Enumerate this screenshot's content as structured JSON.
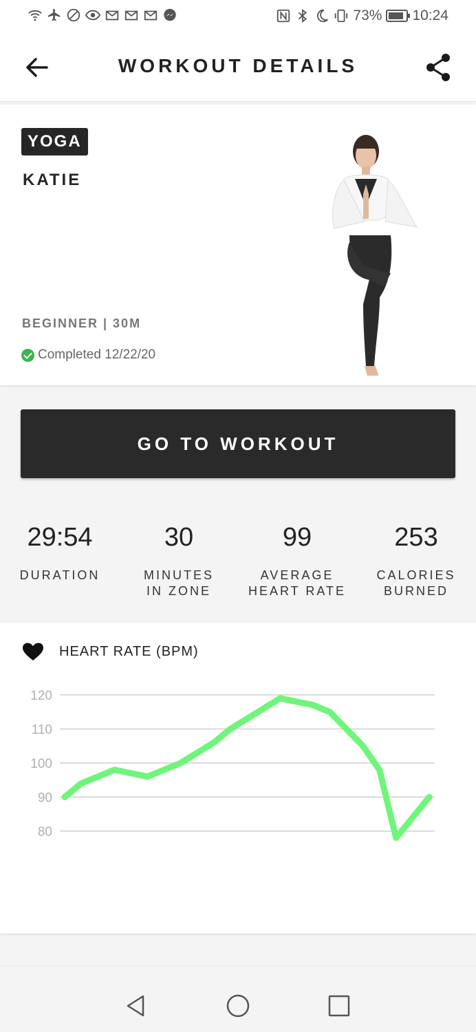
{
  "status_bar": {
    "left_icons": [
      "wifi-icon",
      "airplane-icon",
      "blocked-icon",
      "eye-icon",
      "gmail-icon",
      "gmail-icon",
      "gmail-icon",
      "messenger-icon"
    ],
    "right_icons": [
      "nfc-icon",
      "bluetooth-icon",
      "moon-icon",
      "vibrate-icon"
    ],
    "battery": "73%",
    "time": "10:24"
  },
  "header": {
    "title": "WORKOUT DETAILS",
    "back_icon": "arrow-left-icon",
    "share_icon": "share-icon"
  },
  "workout": {
    "category": "YOGA",
    "instructor": "KATIE",
    "meta": "BEGINNER | 30M",
    "completed": "Completed 12/22/20"
  },
  "cta": {
    "label": "GO TO WORKOUT"
  },
  "stats": [
    {
      "value": "29:54",
      "label": "DURATION"
    },
    {
      "value": "30",
      "label": "MINUTES\nIN ZONE"
    },
    {
      "value": "99",
      "label": "AVERAGE\nHEART RATE"
    },
    {
      "value": "253",
      "label": "CALORIES\nBURNED"
    }
  ],
  "chart_data": {
    "type": "line",
    "title": "HEART RATE (BPM)",
    "xlabel": "",
    "ylabel": "",
    "y_ticks": [
      120,
      110,
      100,
      90,
      80
    ],
    "ylim": [
      80,
      120
    ],
    "grid": true,
    "line_color": "#6ef57a",
    "series": [
      {
        "values": [
          90,
          94,
          96,
          98,
          97,
          96,
          98,
          100,
          103,
          106,
          110,
          113,
          116,
          119,
          118,
          117,
          115,
          110,
          105,
          98,
          78,
          84,
          90
        ]
      }
    ]
  },
  "nav": {
    "back_icon": "triangle-back-icon",
    "home_icon": "circle-home-icon",
    "recents_icon": "square-recents-icon"
  },
  "colors": {
    "dark": "#262626",
    "accent_green": "#6ef57a",
    "success": "#3bb54a"
  }
}
